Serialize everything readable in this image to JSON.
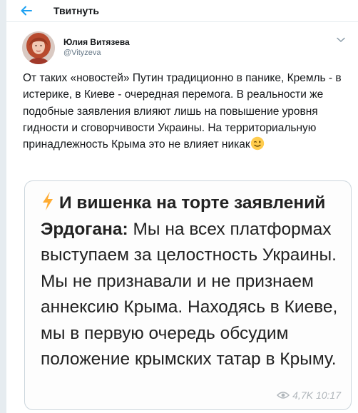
{
  "topbar": {
    "title": "Твитнуть"
  },
  "author": {
    "name": "Юлия Витязева",
    "handle": "@Vityzeva"
  },
  "tweet": {
    "text": "От таких «новостей» Путин традиционно в панике, Кремль - в истерике, в Киеве - очередная перемога. В реальности же подобные заявления влияют лишь на повышение уровня гидности и сговорчивости Украины. На территориальную принадлежность Крыма это не влияет никак"
  },
  "quote": {
    "bold_text": "И вишенка на торте заявлений Эрдогана:",
    "text": " Мы на всех платформах выступаем за целостность Украины. Мы не признавали и не признаем аннексию Крыма. Находясь в Киеве, мы в первую очередь обсудим положение крымских татар в Крыму.",
    "views": "4,7K",
    "time": "10:17"
  },
  "colors": {
    "accent": "#1da1f2",
    "background": "#e6ecf0",
    "text": "#14171a",
    "muted": "#657786"
  },
  "icons": {
    "back": "arrow-left-icon",
    "caret": "chevron-down-icon",
    "emoji": "winking-face-icon",
    "bolt": "lightning-icon",
    "eye": "eye-icon"
  }
}
